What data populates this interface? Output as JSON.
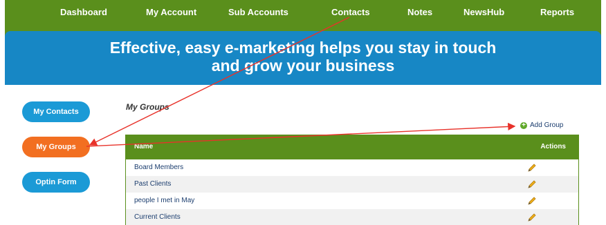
{
  "nav": {
    "items": [
      "Dashboard",
      "My Account",
      "Sub Accounts",
      "Contacts",
      "Notes",
      "NewsHub",
      "Reports"
    ]
  },
  "banner": {
    "line1_bold": "Effective, easy e-marketing",
    "line1_rest": " helps you stay in touch",
    "line2": "and grow your business"
  },
  "sidebar": {
    "items": [
      {
        "label": "My Contacts",
        "active": false
      },
      {
        "label": "My Groups",
        "active": true
      },
      {
        "label": "Optin Form",
        "active": false
      }
    ]
  },
  "groups": {
    "title": "My Groups",
    "add_label": "Add Group",
    "columns": {
      "name": "Name",
      "actions": "Actions"
    },
    "rows": [
      {
        "name": "Board Members"
      },
      {
        "name": "Past Clients"
      },
      {
        "name": "people I met in May"
      },
      {
        "name": "Current Clients"
      }
    ]
  },
  "colors": {
    "nav_green": "#5a8f1c",
    "banner_blue": "#1787c5",
    "pill_blue": "#1b9ad6",
    "pill_active_orange": "#f26f21",
    "annotation_red": "#e8322a"
  },
  "icons": {
    "add": "plus-circle-icon",
    "edit": "pencil-icon"
  }
}
